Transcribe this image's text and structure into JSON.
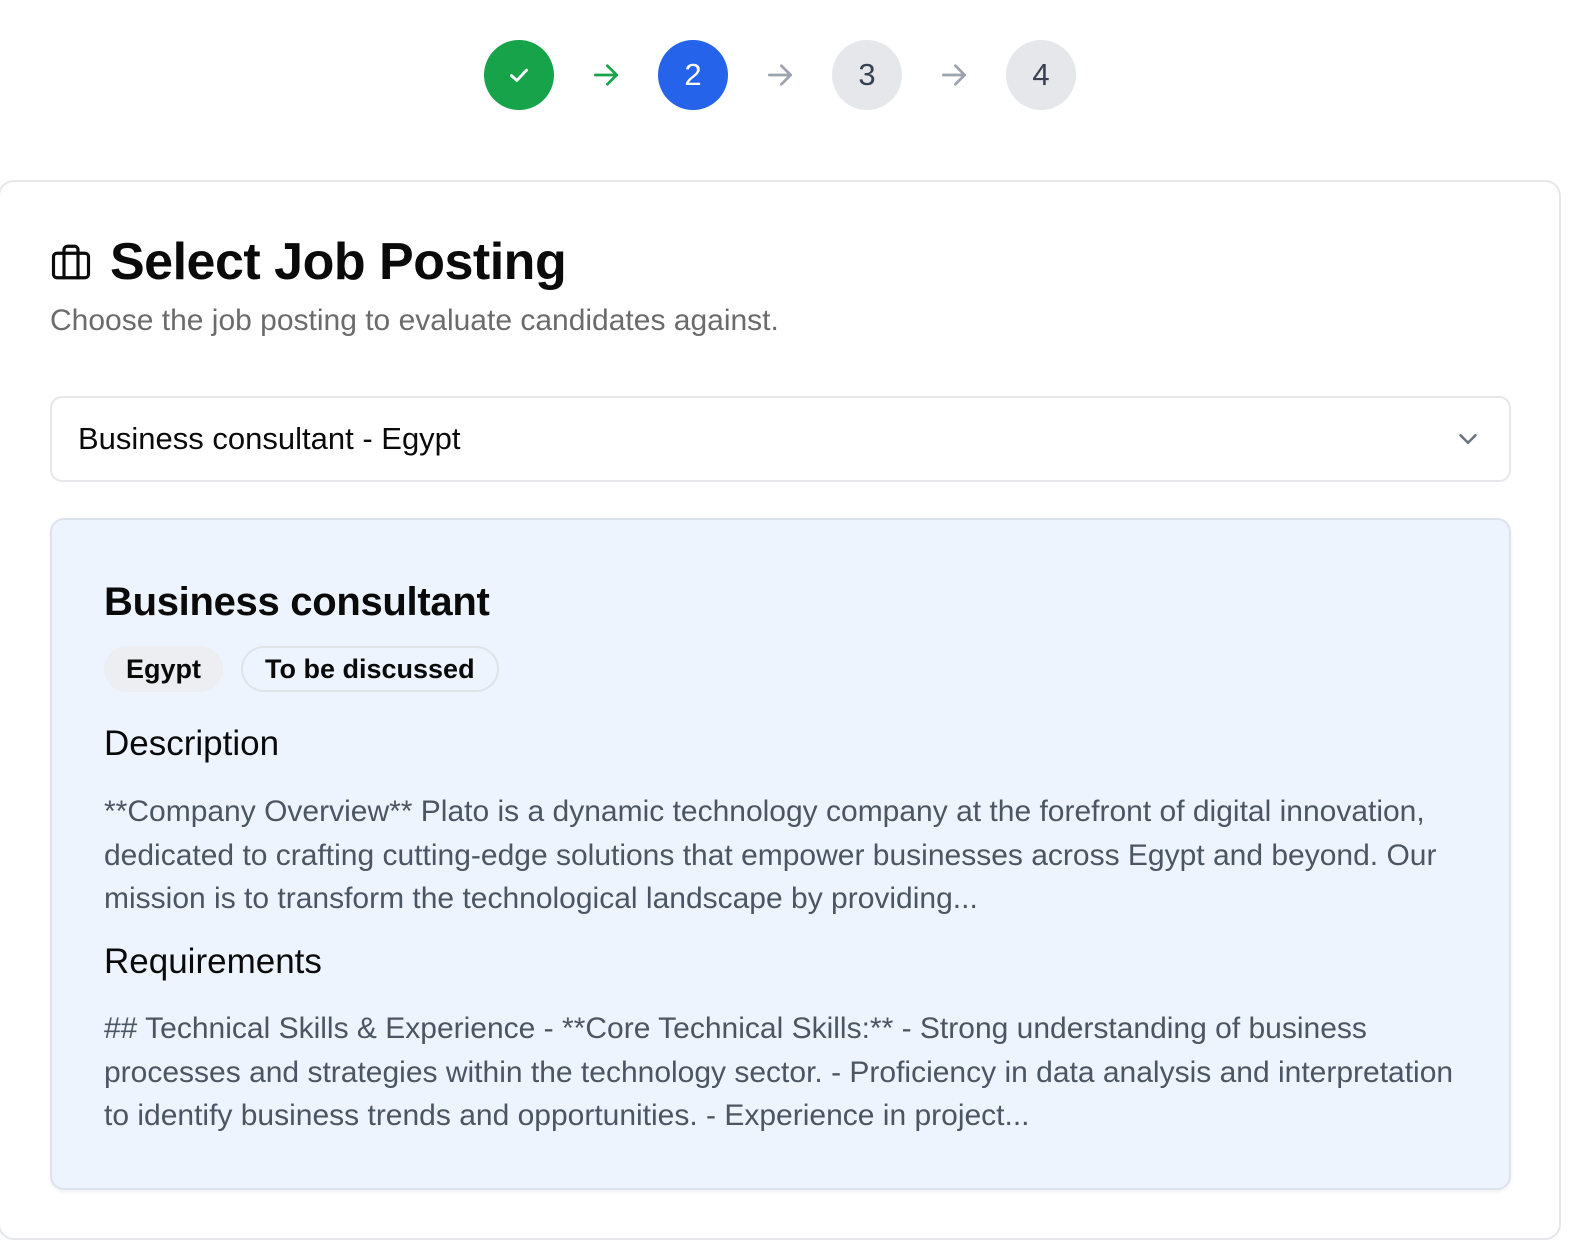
{
  "stepper": {
    "steps": [
      {
        "label": "",
        "state": "completed"
      },
      {
        "label": "2",
        "state": "active"
      },
      {
        "label": "3",
        "state": "pending"
      },
      {
        "label": "4",
        "state": "pending"
      }
    ],
    "colors": {
      "completed": "#16a34a",
      "active": "#2563eb",
      "pending": "#e5e7eb"
    }
  },
  "card": {
    "icon": "briefcase-icon",
    "title": "Select Job Posting",
    "subtitle": "Choose the job posting to evaluate candidates against."
  },
  "job_select": {
    "selected_value": "Business consultant - Egypt"
  },
  "job_details": {
    "title": "Business consultant",
    "badges": [
      "Egypt",
      "To be discussed"
    ],
    "description_heading": "Description",
    "description_text": "**Company Overview** Plato is a dynamic technology company at the forefront of digital innovation, dedicated to crafting cutting-edge solutions that empower businesses across Egypt and beyond. Our mission is to transform the technological landscape by providing...",
    "requirements_heading": "Requirements",
    "requirements_text": "## Technical Skills & Experience - **Core Technical Skills:** - Strong understanding of business processes and strategies within the technology sector. - Proficiency in data analysis and interpretation to identify business trends and opportunities. - Experience in project..."
  }
}
